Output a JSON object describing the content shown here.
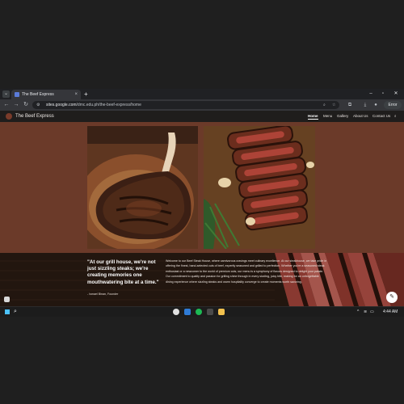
{
  "browser": {
    "tab_title": "The Beef Express",
    "tab_close": "×",
    "new_tab": "+",
    "url_host": "sites.google.com",
    "url_path": "/dmc.edu.ph/the-beef-express/home",
    "error_label": "Error",
    "icons": [
      "back-icon",
      "forward-icon",
      "reload-icon",
      "site-info-icon",
      "zoom-icon",
      "star-icon",
      "extensions-icon",
      "download-icon",
      "profile-icon",
      "menu-icon"
    ]
  },
  "site": {
    "brand": "The Beef Express",
    "nav": [
      {
        "label": "Home",
        "active": true
      },
      {
        "label": "Menu"
      },
      {
        "label": "Gallery"
      },
      {
        "label": "About Us"
      },
      {
        "label": "Contact Us"
      }
    ],
    "quote": "\"At our grill house, we're not just sizzling steaks; we're creating memories one mouthwatering bite at a time.\"",
    "quote_author": "- Ismael Binan, Founder",
    "body_copy": "Welcome to our Beef Steak House, where carnivorous cravings meet culinary excellence. At our steakhouse, we take pride in offering the finest, hand-selected cuts of beef, expertly seasoned and grilled to perfection. Whether you're a seasoned steak enthusiast or a newcomer to the world of premium cuts, our menu is a symphony of flavors designed to delight your palate. Our commitment to quality and passion for grilling shine through in every sizzling, juicy bite, making for an unforgettable dining experience where sizzling steaks and warm hospitality converge to create moments worth savoring.",
    "colors": {
      "page_bg": "#6b3a29",
      "nav_bg": "#1f1d1c",
      "banner_bg": "#2a1b13"
    }
  },
  "taskbar": {
    "time": "4:44 AM",
    "apps": [
      "chrome",
      "vscode",
      "spotify",
      "terminal",
      "file-explorer"
    ]
  }
}
